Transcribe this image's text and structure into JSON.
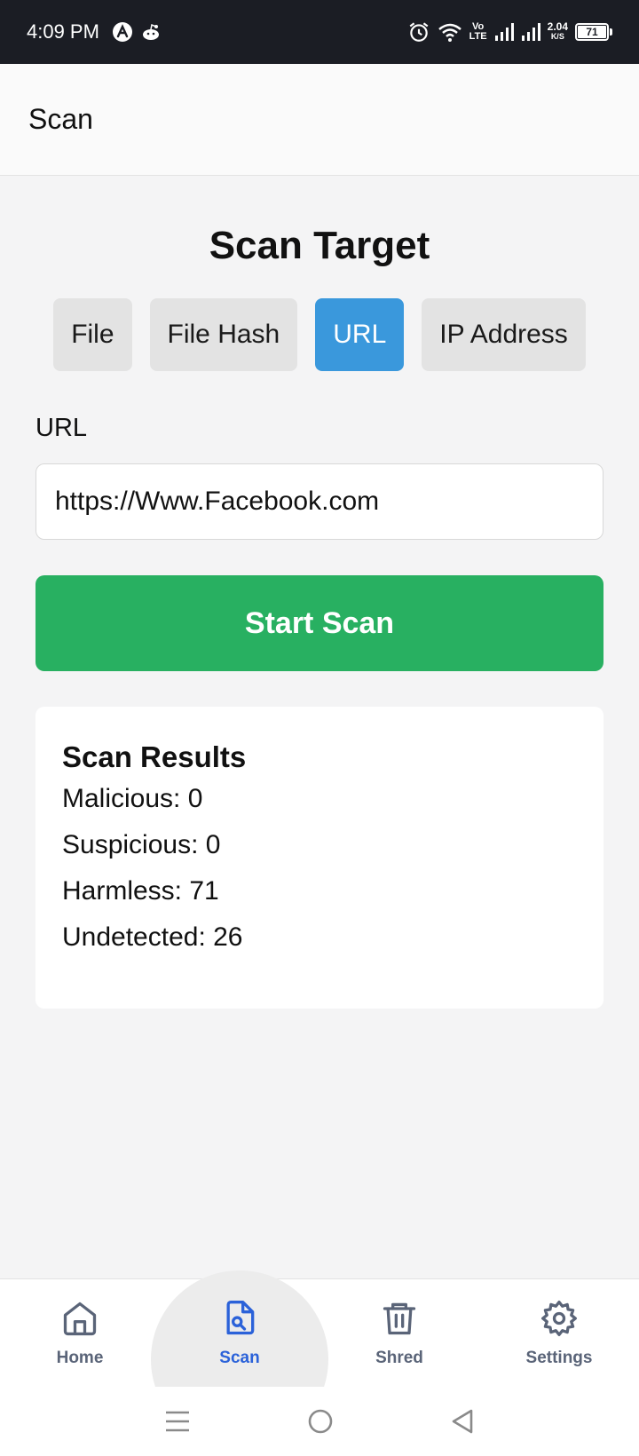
{
  "status_bar": {
    "time": "4:09 PM",
    "volte_top": "Vo",
    "volte_bottom": "LTE",
    "net_speed": "2.04",
    "net_unit": "K/S",
    "battery": "71"
  },
  "header": {
    "title": "Scan"
  },
  "main": {
    "title": "Scan Target",
    "tabs": [
      {
        "label": "File",
        "active": false
      },
      {
        "label": "File Hash",
        "active": false
      },
      {
        "label": "URL",
        "active": true
      },
      {
        "label": "IP Address",
        "active": false
      }
    ],
    "url_label": "URL",
    "url_value": "https://Www.Facebook.com",
    "scan_button": "Start Scan"
  },
  "results": {
    "title": "Scan Results",
    "lines": [
      "Malicious: 0",
      "Suspicious: 0",
      "Harmless: 71",
      "Undetected: 26"
    ]
  },
  "bottom_nav": {
    "items": [
      {
        "label": "Home",
        "icon": "home-icon"
      },
      {
        "label": "Scan",
        "icon": "scan-file-icon",
        "active": true
      },
      {
        "label": "Shred",
        "icon": "trash-icon"
      },
      {
        "label": "Settings",
        "icon": "gear-icon"
      }
    ]
  },
  "colors": {
    "accent_blue": "#3a98dc",
    "scan_green": "#28b061",
    "nav_active": "#2b62d9",
    "nav_inactive": "#5a6478"
  }
}
